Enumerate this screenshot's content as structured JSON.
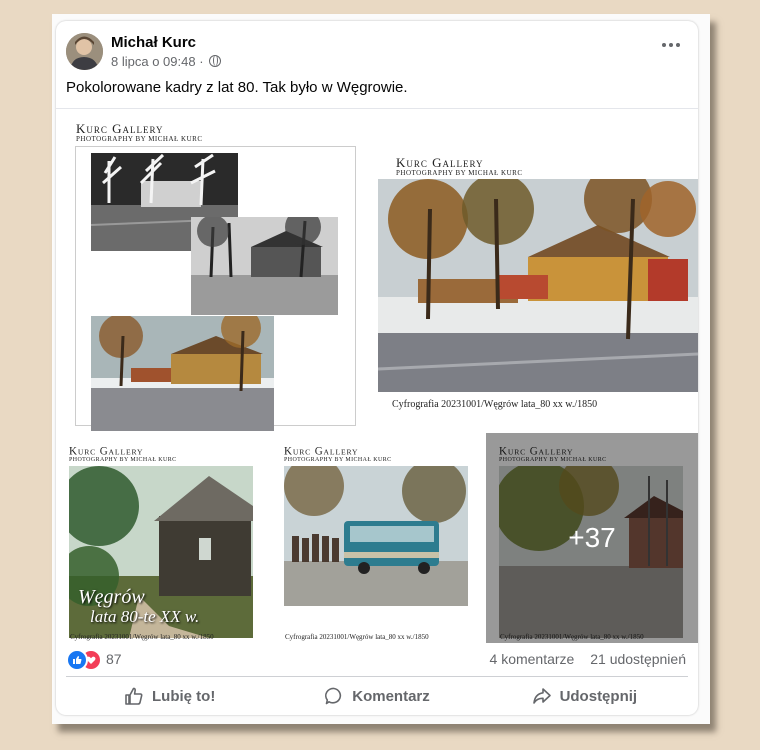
{
  "post": {
    "author": "Michał Kurc",
    "date": "8 lipca o 09:48",
    "separator": "·",
    "text": "Pokolorowane kadry z lat 80. Tak było w Węgrowie."
  },
  "tiles": {
    "brand_line1": "Kurc Gallery",
    "brand_line2": "PHOTOGRAPHY BY MICHAŁ KURC",
    "big_caption": "Cyfrografia 20231001/Węgrów lata_80 xx w./1850",
    "small_caption": "Cyfrografia 20231001/Węgrów lata_80 xx w./1850",
    "poster_title_1": "Węgrów",
    "poster_title_2": "lata 80-te XX w.",
    "more_count": "+37"
  },
  "stats": {
    "reactions_count": "87",
    "comments": "4 komentarze",
    "shares": "21 udostępnień"
  },
  "actions": {
    "like": "Lubię to!",
    "comment": "Komentarz",
    "share": "Udostępnij"
  },
  "colors": {
    "background": "#e9d9c3",
    "like_blue": "#1877f2",
    "love_red": "#f33e58",
    "secondary_text": "#65676b"
  },
  "icons": [
    "globe-icon",
    "more-options-icon",
    "like-reaction-icon",
    "love-reaction-icon",
    "thumbs-up-icon",
    "comment-icon",
    "share-icon"
  ]
}
